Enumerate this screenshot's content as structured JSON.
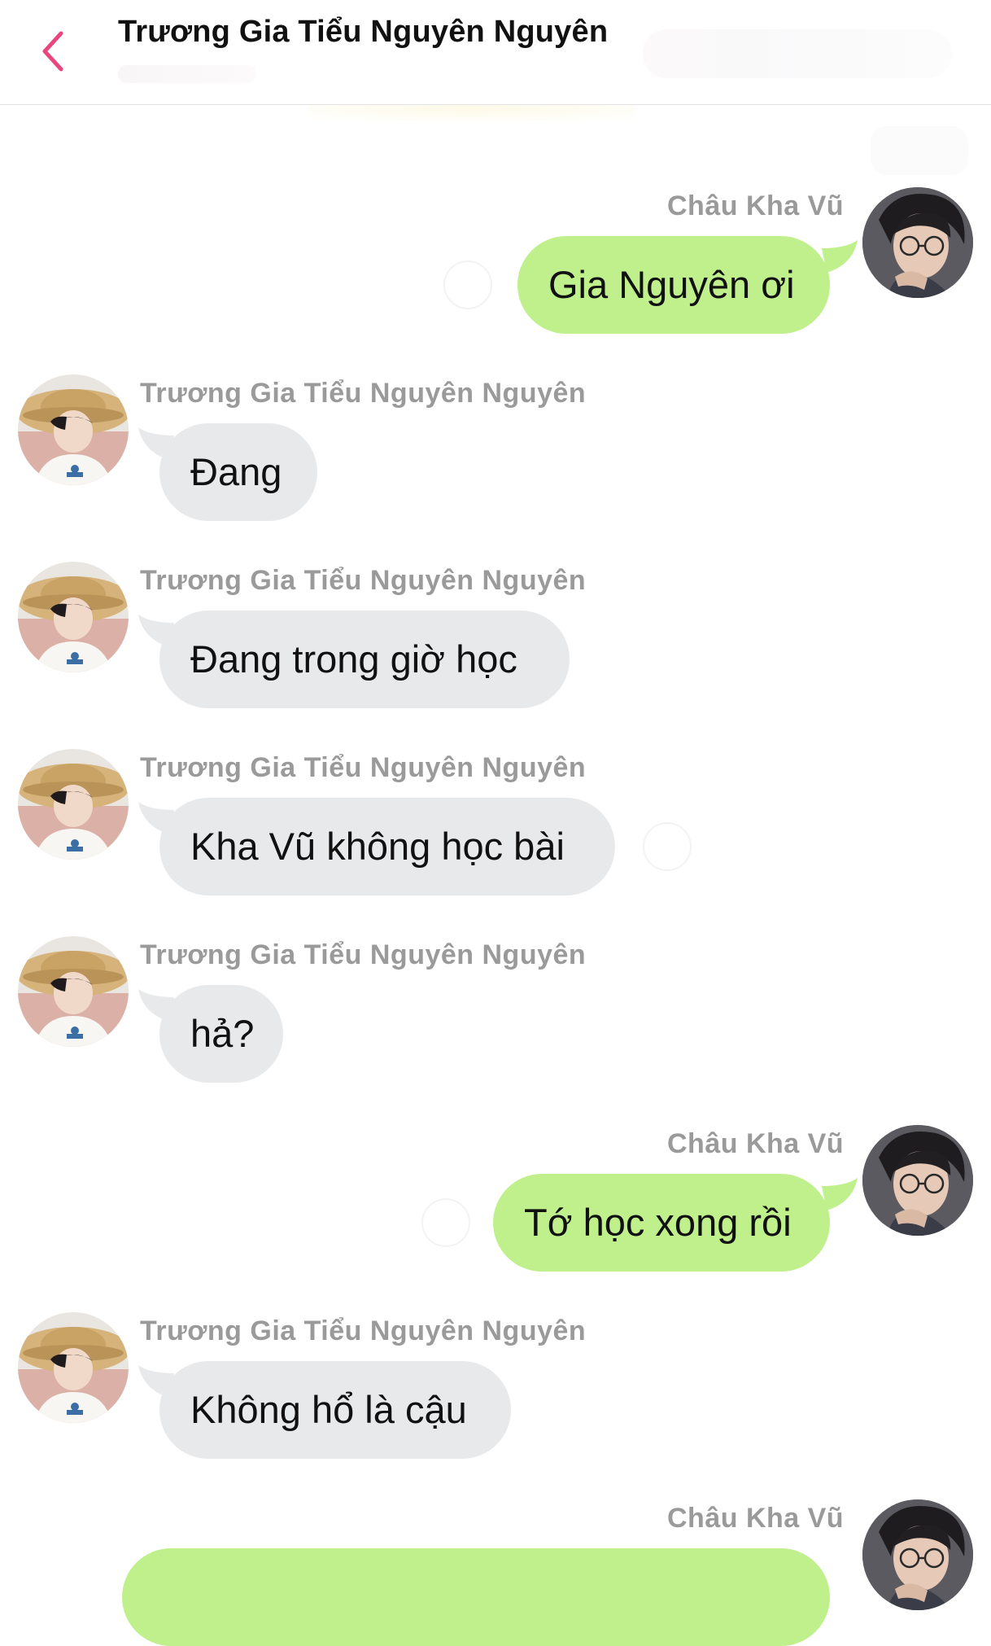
{
  "header": {
    "title": "Trương Gia Tiểu Nguyên Nguyên",
    "back_icon": "chevron-left-icon",
    "accent_color": "#e8467c"
  },
  "colors": {
    "incoming_bubble": "#e8e9eb",
    "outgoing_bubble": "#bff08c",
    "sender_name": "#9a9a9a"
  },
  "messages": [
    {
      "direction": "out",
      "sender": "Châu Kha Vũ",
      "text": "Gia Nguyên ơi"
    },
    {
      "direction": "in",
      "sender": "Trương Gia Tiểu Nguyên Nguyên",
      "text": "Đang"
    },
    {
      "direction": "in",
      "sender": "Trương Gia Tiểu Nguyên Nguyên",
      "text": "Đang trong giờ học"
    },
    {
      "direction": "in",
      "sender": "Trương Gia Tiểu Nguyên Nguyên",
      "text": "Kha Vũ không học bài"
    },
    {
      "direction": "in",
      "sender": "Trương Gia Tiểu Nguyên Nguyên",
      "text": "hả?"
    },
    {
      "direction": "out",
      "sender": "Châu Kha Vũ",
      "text": "Tớ học xong rồi"
    },
    {
      "direction": "in",
      "sender": "Trương Gia Tiểu Nguyên Nguyên",
      "text": "Không hổ là cậu"
    },
    {
      "direction": "out",
      "sender": "Châu Kha Vũ",
      "text": ""
    }
  ]
}
